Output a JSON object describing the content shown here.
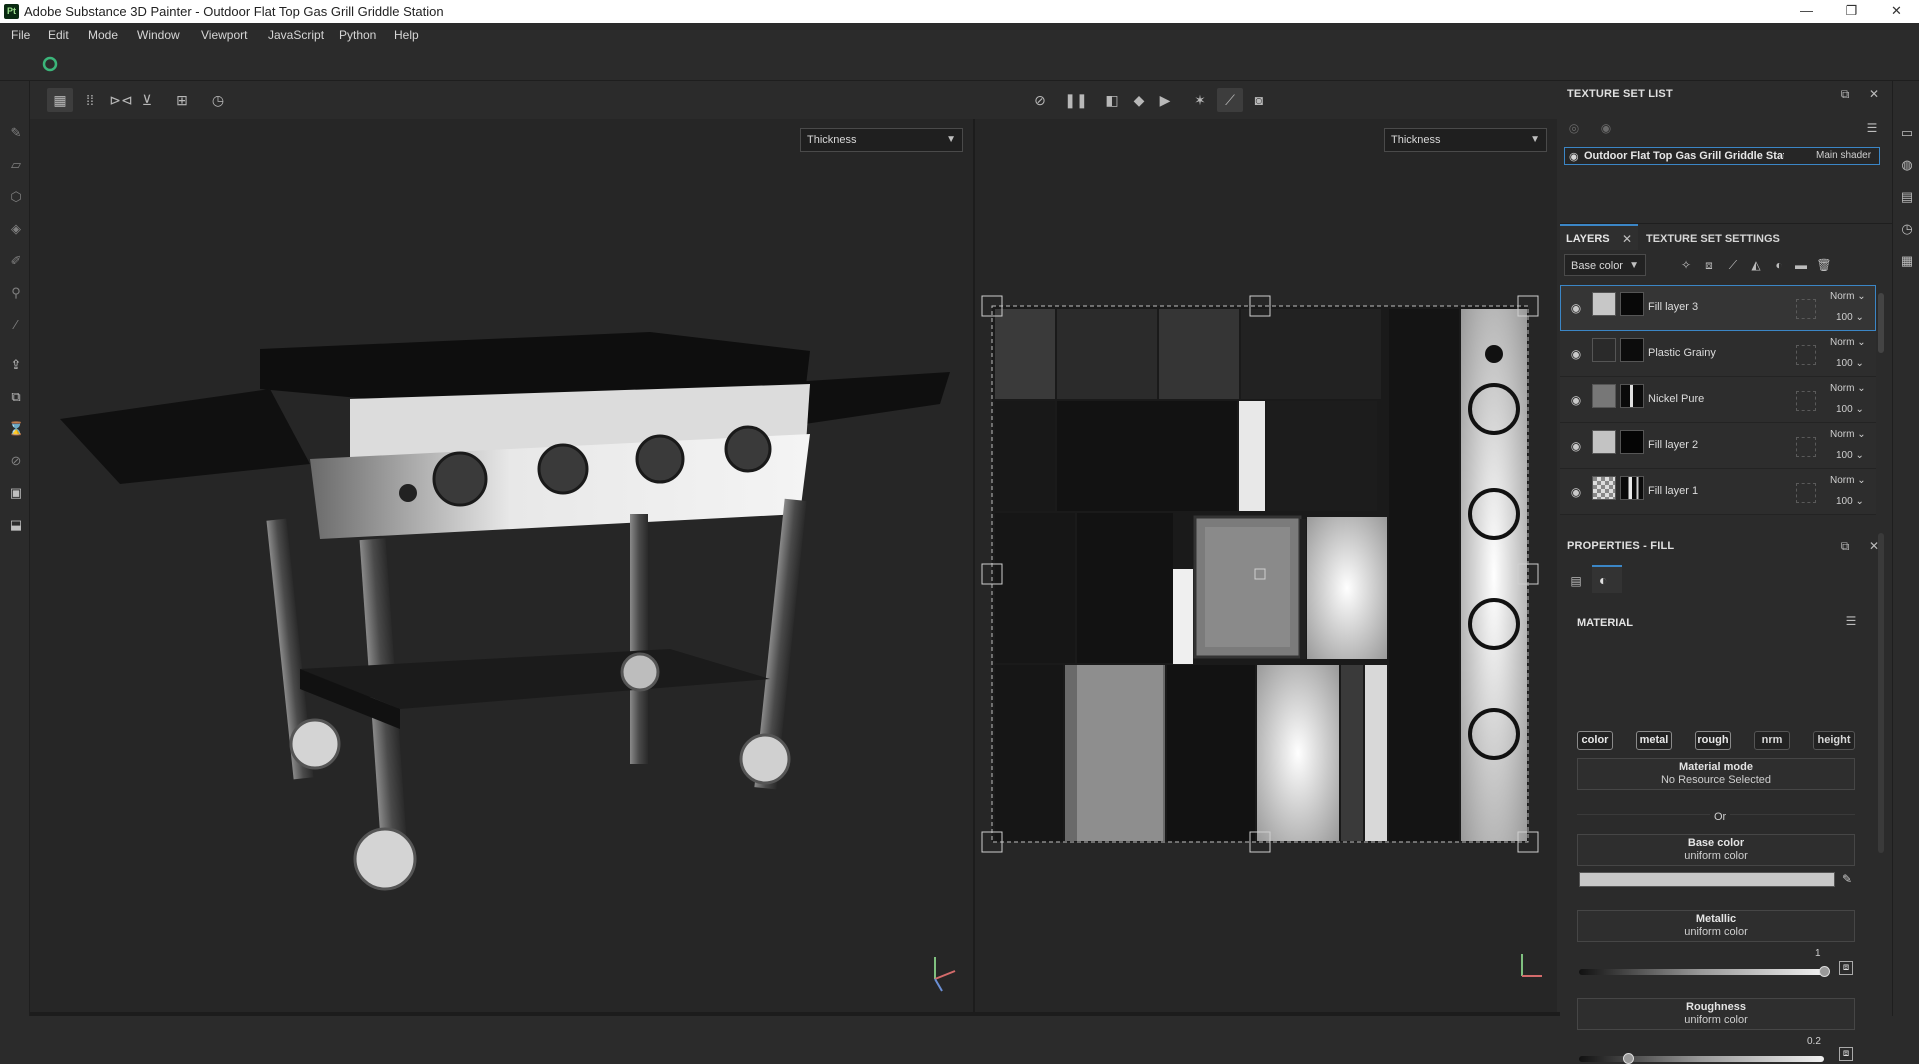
{
  "window": {
    "app_icon": "Pt",
    "title": "Adobe Substance 3D Painter - Outdoor Flat Top Gas Grill Griddle Station",
    "minimize": "—",
    "maximize": "❐",
    "close": "✕"
  },
  "menu": [
    "File",
    "Edit",
    "Mode",
    "Window",
    "Viewport",
    "JavaScript",
    "Python",
    "Help"
  ],
  "viewport": {
    "left_channel": "Thickness",
    "right_channel": "Thickness"
  },
  "texture_set_list": {
    "title": "TEXTURE SET LIST",
    "item_name": "Outdoor Flat Top Gas Grill Griddle Stati",
    "item_shader": "Main shader"
  },
  "layers_panel": {
    "tab_layers": "LAYERS",
    "tab_settings": "TEXTURE SET SETTINGS",
    "channel_select": "Base color",
    "layers": [
      {
        "name": "Fill layer 3",
        "blend": "Norm",
        "opacity": "100",
        "selected": true
      },
      {
        "name": "Plastic Grainy",
        "blend": "Norm",
        "opacity": "100",
        "selected": false
      },
      {
        "name": "Nickel Pure",
        "blend": "Norm",
        "opacity": "100",
        "selected": false
      },
      {
        "name": "Fill layer 2",
        "blend": "Norm",
        "opacity": "100",
        "selected": false
      },
      {
        "name": "Fill layer 1",
        "blend": "Norm",
        "opacity": "100",
        "selected": false
      }
    ]
  },
  "properties": {
    "title": "PROPERTIES - FILL",
    "section": "MATERIAL",
    "channels": [
      "color",
      "metal",
      "rough",
      "nrm",
      "height"
    ],
    "material_mode_title": "Material mode",
    "material_mode_value": "No Resource Selected",
    "or_label": "Or",
    "base_color_title": "Base color",
    "base_color_sub": "uniform color",
    "base_color_swatch": "#c8c8c8",
    "metallic_title": "Metallic",
    "metallic_sub": "uniform color",
    "metallic_value": "1",
    "metallic_level": 1.0,
    "roughness_title": "Roughness",
    "roughness_sub": "uniform color",
    "roughness_value": "0.2",
    "roughness_level": 0.2
  },
  "colors": {
    "accent": "#3b86c6",
    "bg": "#2b2b2b",
    "viewport_bg": "#262626"
  }
}
